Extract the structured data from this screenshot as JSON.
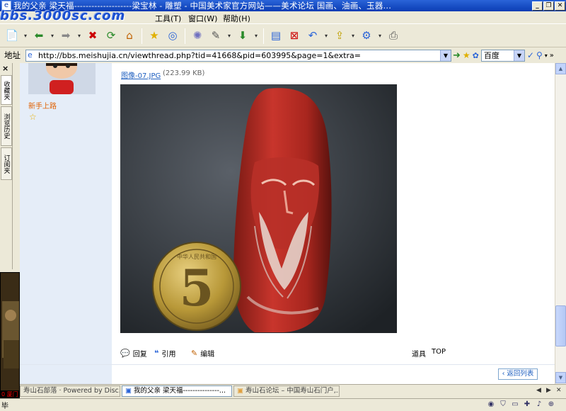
{
  "window": {
    "title": "我的父亲 梁天福--------------------梁宝林 - 雕塑 - 中国美术家官方网站——美术论坛 国画、油画、玉器...",
    "app_icon": "e-icon",
    "buttons": [
      "minimize",
      "restore",
      "close"
    ]
  },
  "logo": {
    "text": "bbs.3000sc.com"
  },
  "menu": {
    "items": [
      {
        "label": "工具(T)"
      },
      {
        "label": "窗口(W)"
      },
      {
        "label": "帮助(H)"
      }
    ]
  },
  "toolbar": {
    "buttons": [
      "new-page-icon",
      "back-icon",
      "forward-icon",
      "stop-icon",
      "refresh-icon",
      "home-icon",
      "favorites-icon",
      "history-icon",
      "settings-icon",
      "tools-icon",
      "download-icon",
      "view-icon",
      "block-icon",
      "undo-icon",
      "sync-icon",
      "network-icon",
      "print-icon"
    ]
  },
  "address": {
    "label": "地址",
    "url": "http://bbs.meishujia.cn/viewthread.php?tid=41668&pid=603995&page=1&extra=",
    "search_engine": "百度"
  },
  "sidebar": {
    "close": "×",
    "tabs": [
      "收藏夹",
      "浏览历史",
      "订阅夹"
    ]
  },
  "thumbnail": {
    "caption": "0 厦门"
  },
  "post": {
    "author_rank": "新手上路",
    "attachment_name": "图像-07.JPG",
    "attachment_size": "(223.99 KB)",
    "actions": {
      "reply": "回复",
      "quote": "引用",
      "edit": "编辑",
      "tools": "道具",
      "top": "TOP"
    },
    "back_to_list": "返回列表"
  },
  "photo": {
    "coin_value": "5",
    "coin_text": "中华人民共和国"
  },
  "tabs": [
    {
      "label": "寿山石部落 · Powered by Disc...",
      "active": false
    },
    {
      "label": "我的父亲 梁天福---------------...",
      "active": true
    },
    {
      "label": "寿山石论坛 – 中国寿山石门户,...",
      "active": false
    }
  ],
  "status": {
    "text": "毕"
  },
  "colors": {
    "titlebar": "#0a3cb4",
    "link": "#2060c0",
    "rank": "#e06000"
  }
}
